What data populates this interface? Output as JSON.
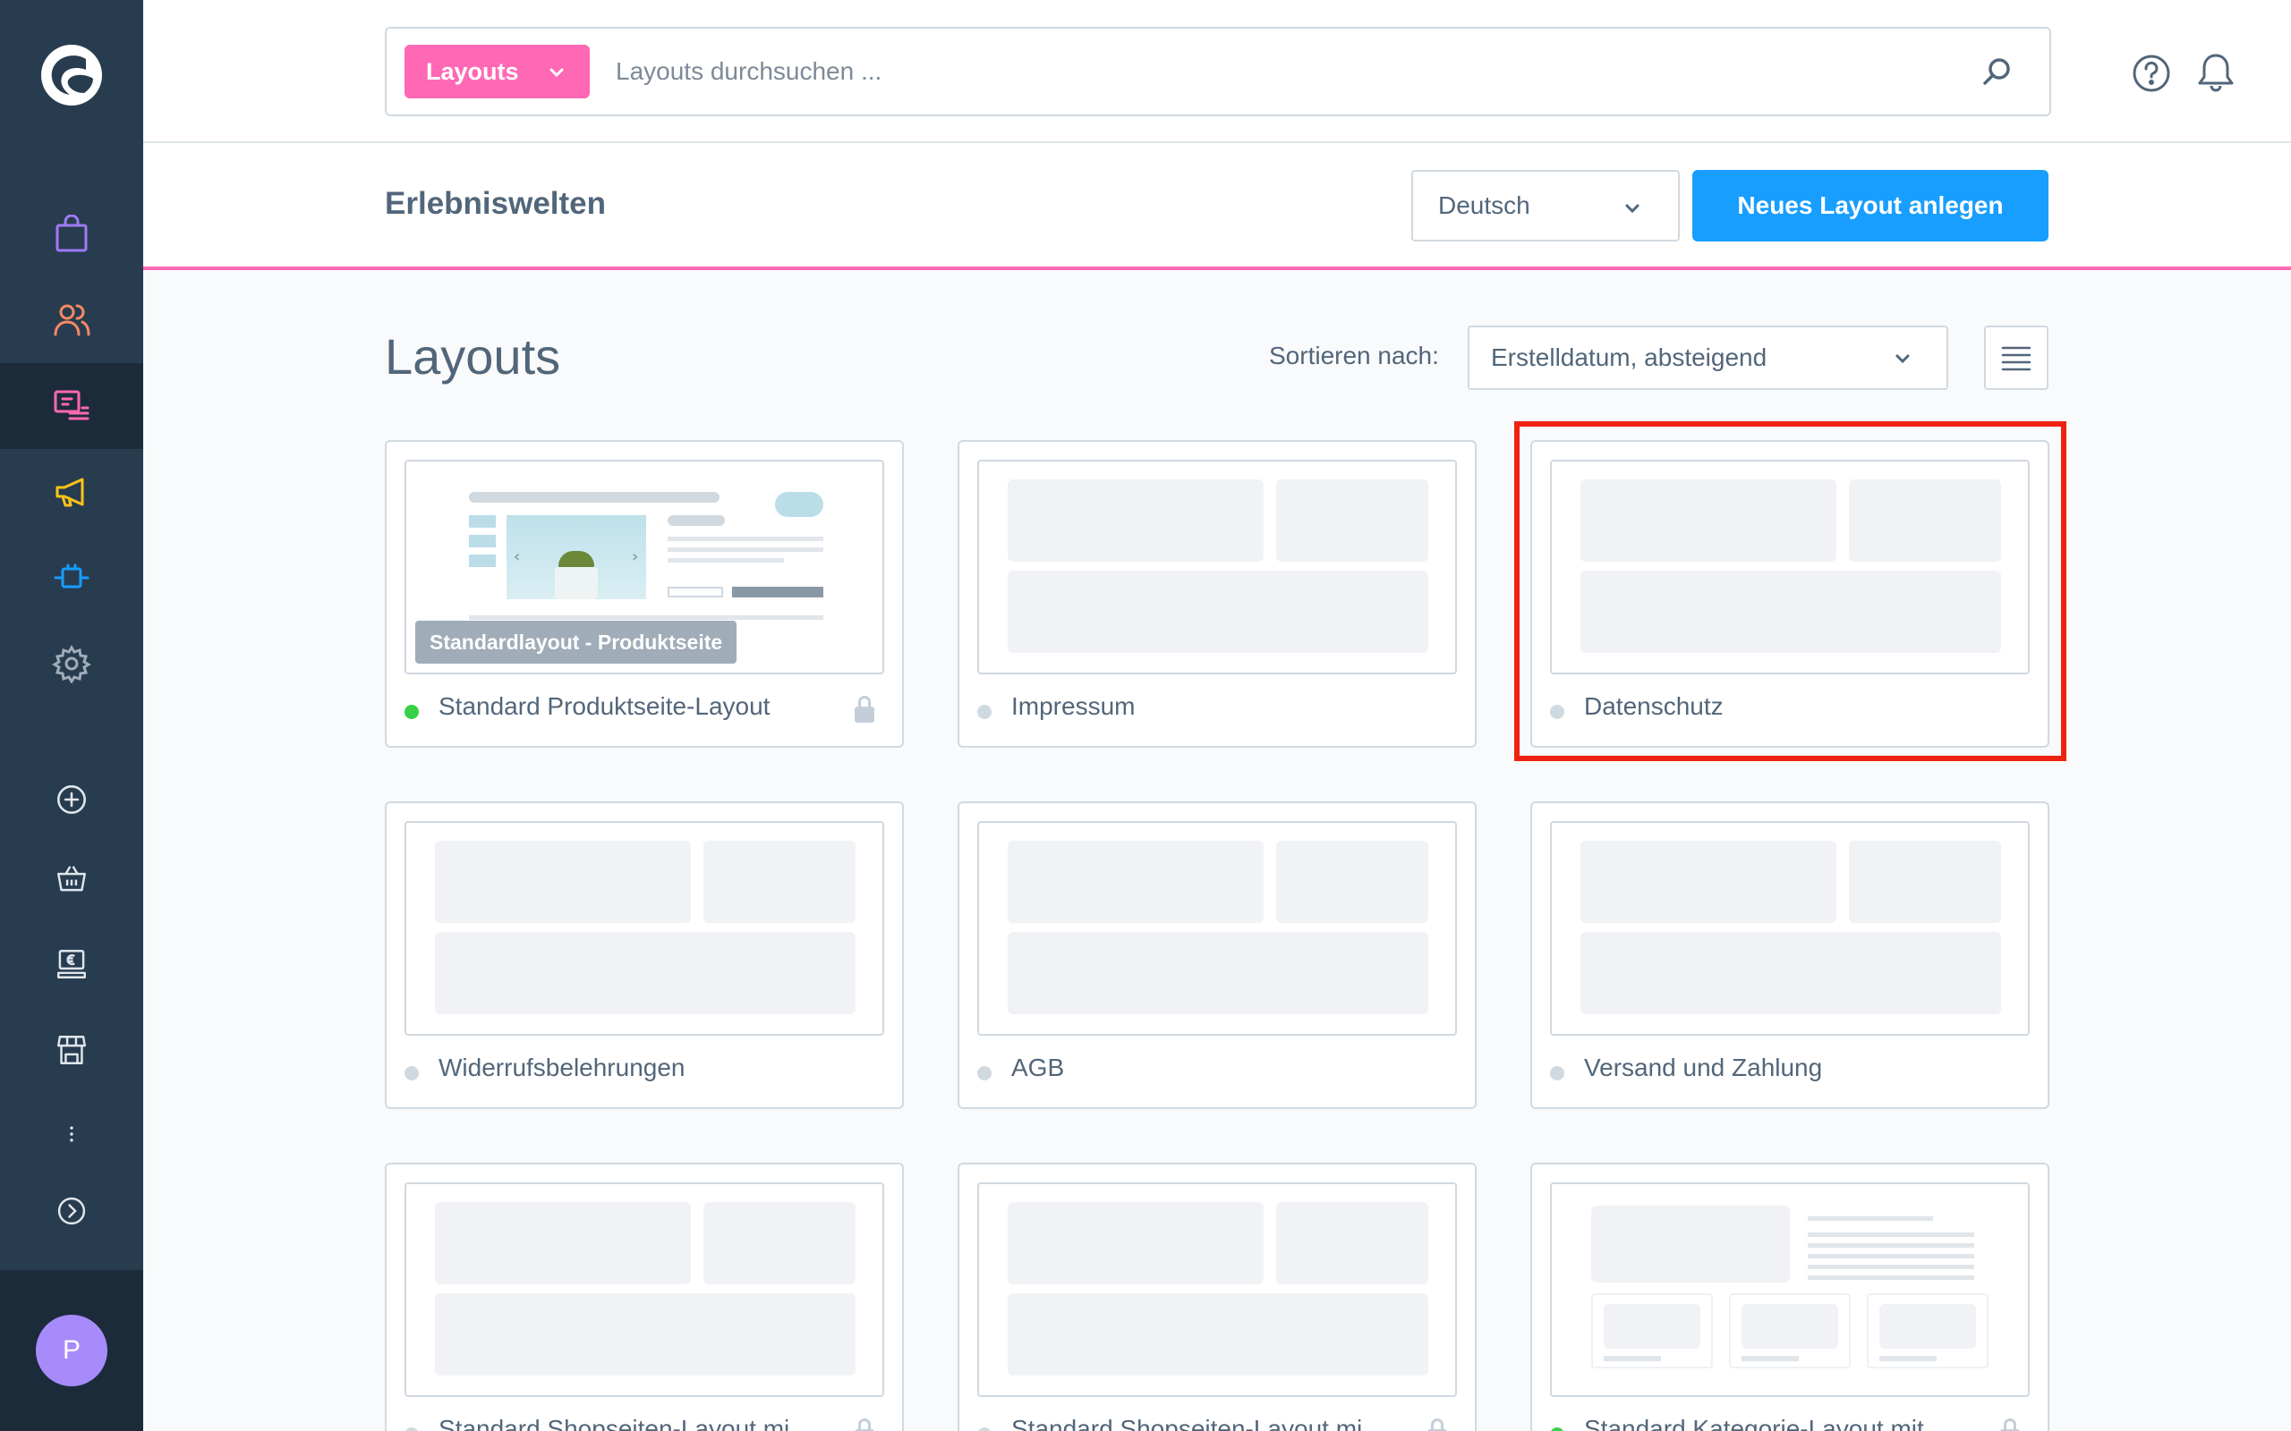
{
  "search": {
    "type_label": "Layouts",
    "placeholder": "Layouts durchsuchen ..."
  },
  "smartbar": {
    "title": "Erlebniswelten",
    "language": "Deutsch",
    "create_button": "Neues Layout anlegen"
  },
  "content": {
    "title": "Layouts",
    "sort_label": "Sortieren nach:",
    "sort_value": "Erstelldatum, absteigend"
  },
  "sidebar": {
    "avatar_initial": "P",
    "icons": [
      "catalogue-icon",
      "customers-icon",
      "content-icon",
      "marketing-icon",
      "extensions-icon",
      "settings-icon",
      "add-icon",
      "sales-channel-basket-icon",
      "sales-channel-pos-icon",
      "sales-channel-store-icon",
      "more-icon",
      "expand-icon"
    ]
  },
  "cards": [
    {
      "name": "Standard Produktseite-Layout",
      "active": true,
      "locked": true,
      "preview_label": "Standardlayout - Produktseite"
    },
    {
      "name": "Impressum",
      "active": false,
      "locked": false
    },
    {
      "name": "Datenschutz",
      "active": false,
      "locked": false
    },
    {
      "name": "Widerrufsbelehrungen",
      "active": false,
      "locked": false
    },
    {
      "name": "AGB",
      "active": false,
      "locked": false
    },
    {
      "name": "Versand und Zahlung",
      "active": false,
      "locked": false
    },
    {
      "name": "Standard Shopseiten-Layout mi",
      "active": false,
      "locked": true
    },
    {
      "name": "Standard Shopseiten-Layout mi",
      "active": false,
      "locked": true
    },
    {
      "name": "Standard Kategorie-Layout mit",
      "active": true,
      "locked": true
    }
  ],
  "colors": {
    "sidebar": "#283c50",
    "accent_pink": "#ff68b4",
    "primary_blue": "#189eff",
    "highlight_red": "#ee2211"
  }
}
